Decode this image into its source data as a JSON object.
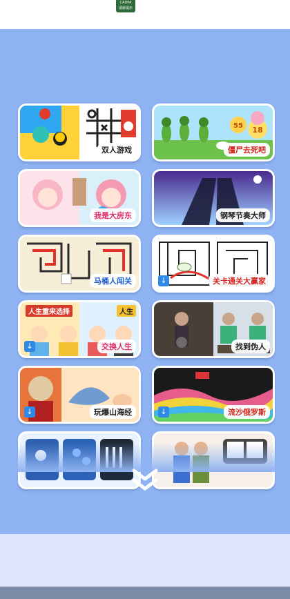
{
  "header": {
    "badge_line1": "CADPA",
    "badge_line2": "适龄提示"
  },
  "games": [
    {
      "title": "双人游戏",
      "download": false
    },
    {
      "title": "僵尸去死吧",
      "download": false
    },
    {
      "title": "我是大房东",
      "download": false
    },
    {
      "title": "钢琴节奏大师",
      "download": false
    },
    {
      "title": "马桶人闯关",
      "download": false
    },
    {
      "title": "关卡通关大赢家",
      "download": true
    },
    {
      "title": "交换人生",
      "download": true,
      "art_text_1": "人生重来选择",
      "art_text_2": "人生"
    },
    {
      "title": "找到伪人",
      "download": false
    },
    {
      "title": "玩爆山海经",
      "download": true
    },
    {
      "title": "流沙俄罗斯",
      "download": true
    }
  ],
  "zombie_numbers": [
    "55",
    "18"
  ],
  "colors": {
    "page_bg": "#8fb3f2",
    "download_button": "#2d8ae6"
  },
  "more_icon": "double-chevron-down-icon"
}
